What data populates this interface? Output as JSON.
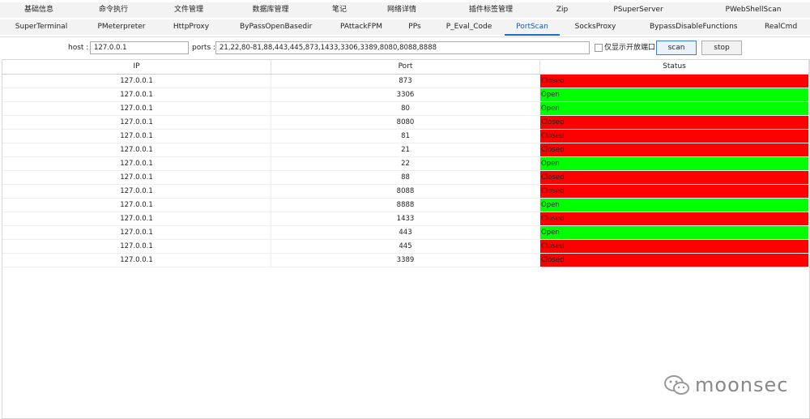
{
  "tabs_row1": [
    "基础信息",
    "命令执行",
    "文件管理",
    "数据库管理",
    "笔记",
    "网络详情",
    "插件标签管理",
    "Zip",
    "PSuperServer",
    "PWebShellScan"
  ],
  "tabs_row2": [
    "SuperTerminal",
    "PMeterpreter",
    "HttpProxy",
    "ByPassOpenBasedir",
    "PAttackFPM",
    "PPs",
    "P_Eval_Code",
    "PortScan",
    "SocksProxy",
    "BypassDisableFunctions",
    "RealCmd"
  ],
  "active_tab": "PortScan",
  "toolbar": {
    "host_label": "host :",
    "host_value": "127.0.0.1",
    "ports_label": "ports :",
    "ports_value": "21,22,80-81,88,443,445,873,1433,3306,3389,8080,8088,8888",
    "only_open_label": "仅显示开放端口",
    "only_open_checked": false,
    "scan_label": "scan",
    "stop_label": "stop"
  },
  "table": {
    "columns": [
      "IP",
      "Port",
      "Status"
    ],
    "rows": [
      {
        "ip": "127.0.0.1",
        "port": "873",
        "status": "Closed"
      },
      {
        "ip": "127.0.0.1",
        "port": "3306",
        "status": "Open"
      },
      {
        "ip": "127.0.0.1",
        "port": "80",
        "status": "Open"
      },
      {
        "ip": "127.0.0.1",
        "port": "8080",
        "status": "Closed"
      },
      {
        "ip": "127.0.0.1",
        "port": "81",
        "status": "Closed"
      },
      {
        "ip": "127.0.0.1",
        "port": "21",
        "status": "Closed"
      },
      {
        "ip": "127.0.0.1",
        "port": "22",
        "status": "Open"
      },
      {
        "ip": "127.0.0.1",
        "port": "88",
        "status": "Closed"
      },
      {
        "ip": "127.0.0.1",
        "port": "8088",
        "status": "Closed"
      },
      {
        "ip": "127.0.0.1",
        "port": "8888",
        "status": "Open"
      },
      {
        "ip": "127.0.0.1",
        "port": "1433",
        "status": "Closed"
      },
      {
        "ip": "127.0.0.1",
        "port": "443",
        "status": "Open"
      },
      {
        "ip": "127.0.0.1",
        "port": "445",
        "status": "Closed"
      },
      {
        "ip": "127.0.0.1",
        "port": "3389",
        "status": "Closed"
      }
    ]
  },
  "status_colors": {
    "Open": "#00ff00",
    "Closed": "#ff0000"
  },
  "watermark": {
    "text": "moonsec",
    "icon": "wechat-icon"
  }
}
